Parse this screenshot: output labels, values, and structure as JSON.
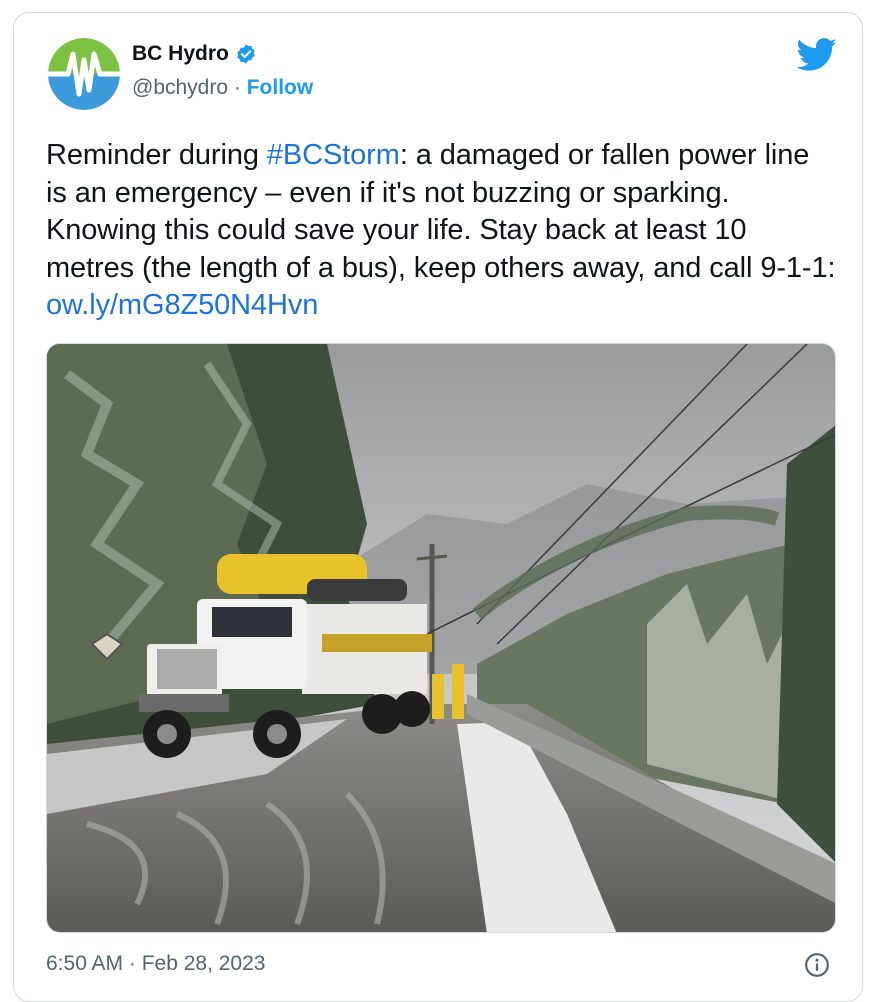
{
  "tweet": {
    "author_name": "BC Hydro",
    "handle": "@bchydro",
    "separator": "·",
    "follow_label": "Follow",
    "text_before": "Reminder during ",
    "hashtag": "#BCStorm",
    "text_after": ":  a damaged or fallen power line is an emergency – even if it's not buzzing or sparking. Knowing this could save your life. Stay back at least 10 metres (the length of a bus), keep others away, and call 9-1-1: ",
    "url_text": "ow.ly/mG8Z50N4Hvn",
    "timestamp": "6:50 AM · Feb 28, 2023"
  },
  "icons": {
    "avatar": "bc-hydro-logo",
    "verified": "verified-badge-icon",
    "platform": "twitter-bird-icon",
    "info": "info-icon"
  },
  "colors": {
    "accent": "#1d9bf0",
    "link": "#1d74d8",
    "text": "#0f1419",
    "muted": "#536471",
    "logo_green": "#7cc142",
    "logo_blue": "#3b9ad9"
  }
}
